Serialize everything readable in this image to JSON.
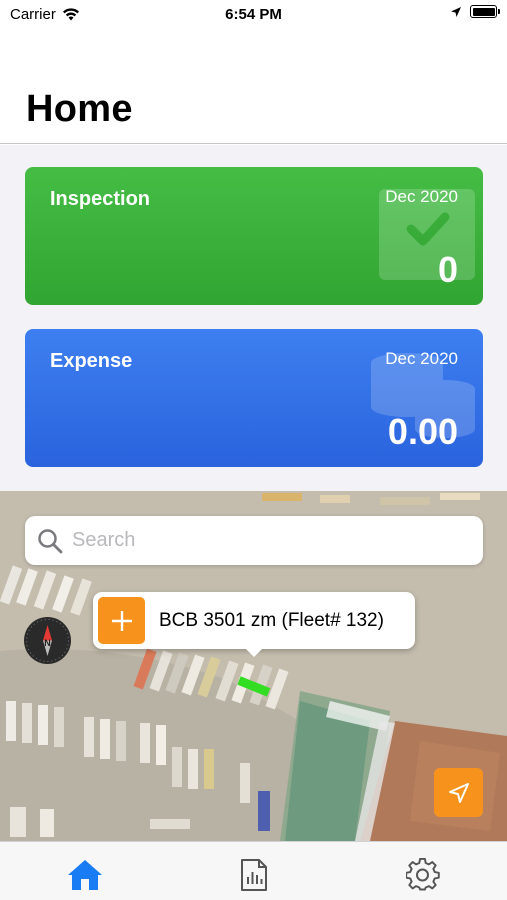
{
  "status_bar": {
    "carrier": "Carrier",
    "time": "6:54 PM"
  },
  "header": {
    "title": "Home"
  },
  "cards": {
    "inspection": {
      "title": "Inspection",
      "date": "Dec 2020",
      "value": "0",
      "color": "#3db53d",
      "icon": "checkmark-icon"
    },
    "expense": {
      "title": "Expense",
      "date": "Dec 2020",
      "value": "0.00",
      "color": "#3270e6",
      "icon": "coins-icon"
    }
  },
  "map": {
    "search_placeholder": "Search",
    "callout": {
      "label": "BCB 3501 zm (Fleet# 132)",
      "button_icon": "plus-icon"
    },
    "compass_label": "N",
    "locate_icon": "location-arrow-icon",
    "accent_color": "#f7931d"
  },
  "tab_bar": {
    "items": [
      {
        "name": "home",
        "icon": "home-icon",
        "active": true,
        "color": "#1a7cf5"
      },
      {
        "name": "reports",
        "icon": "report-document-icon",
        "active": false
      },
      {
        "name": "settings",
        "icon": "gear-icon",
        "active": false
      }
    ]
  }
}
